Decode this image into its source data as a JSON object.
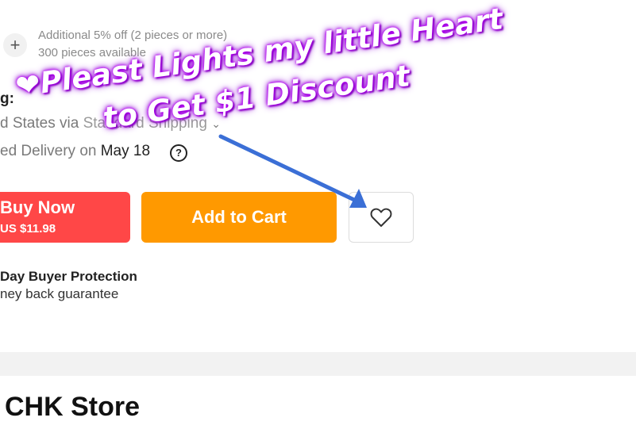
{
  "quantity": {
    "add_icon": "plus-icon",
    "discount_note": "Additional 5% off (2 pieces or more)",
    "availability": "300 pieces available"
  },
  "shipping": {
    "label_fragment": "g:",
    "method_fragment": "d States via",
    "method_obscured": "Standard Shipping",
    "delivery_fragment": "ed Delivery on",
    "delivery_date": "May 18",
    "help_icon": "question-circle-icon"
  },
  "actions": {
    "buy_now_label": "Buy Now",
    "buy_now_price": "US $11.98",
    "add_to_cart_label": "Add to Cart",
    "wishlist_icon": "heart-icon"
  },
  "protection": {
    "title": "Day Buyer Protection",
    "subtitle": "ney back guarantee"
  },
  "store": {
    "name": "CHK Store"
  },
  "overlay": {
    "heart": "❤",
    "line1": "Pleast Lights my little Heart",
    "line2": "to Get $1 Discount",
    "arrow_color": "#3b6fd6",
    "glow_color": "#a000e0"
  }
}
